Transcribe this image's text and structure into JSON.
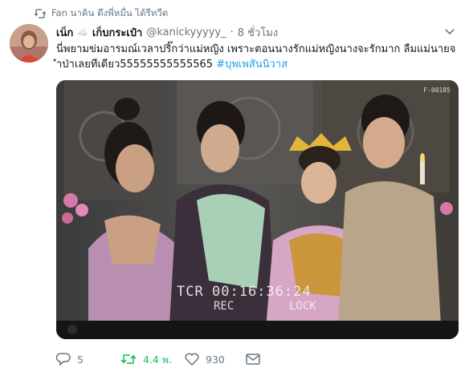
{
  "retweet_context": {
    "text": "Fan นาคิน ดึงพี่หมื่น ได้รีทวีต",
    "icon": "retweet-icon"
  },
  "tweet": {
    "author_name": "เน็ก",
    "author_emoji": "☁️",
    "author_name_suffix": "เก็บกระเป๋า",
    "handle": "@kanickyyyyy_",
    "dot": "·",
    "time": "8 ชั่วโมง",
    "text_plain": "นี่พยามข่มอารมณ์เวลาปริ๊กว่าแม่หญิง เพราะตอนนางรักแม่หญิงนางจะรักมาก ลืมแม่นายจำป่าเลยทีเดียว55555555555565",
    "hashtag": "#บุพเพสันนิวาส"
  },
  "media": {
    "description_icon": "photo-still-frame",
    "frame_code": "F-00185",
    "timecode_label": "TCR",
    "timecode_value": "00:16:36:24",
    "rec_label": "REC",
    "lock_label": "LOCK"
  },
  "actions": {
    "reply_count": "5",
    "retweet_count": "4.4 พ.",
    "like_count": "930",
    "icons": [
      "reply-icon",
      "retweet-icon",
      "like-icon",
      "direct-message-icon"
    ]
  },
  "colors": {
    "text": "#14171a",
    "muted": "#657786",
    "link": "#1da1f2",
    "retweet_green": "#17bf63"
  }
}
